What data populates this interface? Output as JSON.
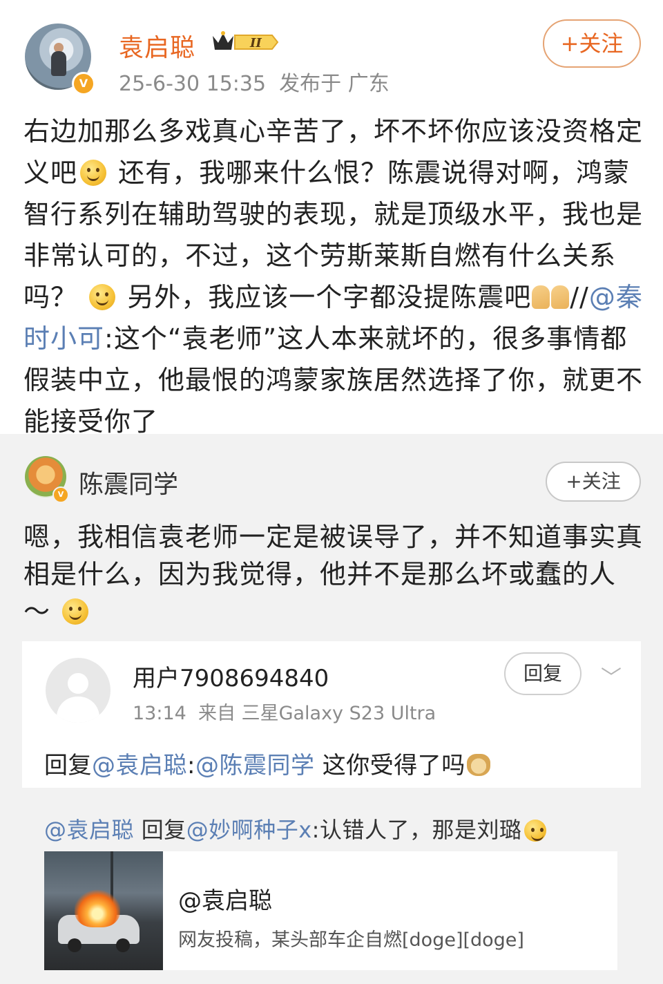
{
  "post": {
    "username": "袁启聪",
    "level_badge": "II",
    "time": "25-6-30 15:35",
    "location": "发布于 广东",
    "follow_label": "+关注",
    "text_part1": "右边加那么多戏真心辛苦了，坏不坏你应该没资格定义吧",
    "text_part2": " 还有，我哪来什么恨？陈震说得对啊，鸿蒙智行系列在辅助驾驶的表现，就是顶级水平，我也是非常认可的，不过，这个劳斯莱斯自燃有什么关系吗？",
    "text_part3": " 另外，我应该一个字都没提陈震吧",
    "text_part4": "//",
    "repost_mention": "@秦时小可",
    "text_part5": ":这个“袁老师”这人本来就坏的，很多事情都假装中立，他最恨的鸿蒙家族居然选择了你，就更不能接受你了"
  },
  "comment": {
    "username": "陈震同学",
    "follow_label": "+关注",
    "text": "嗯，我相信袁老师一定是被误导了，并不知道事实真相是什么，因为我觉得，他并不是那么坏或蠢的人～"
  },
  "reply": {
    "username": "用户7908694840",
    "time": "13:14",
    "source": "来自 三星Galaxy S23 Ultra",
    "reply_button": "回复",
    "prefix": "回复",
    "mention1": "@袁启聪",
    "colon": ":",
    "mention2": "@陈震同学",
    "text": " 这你受得了吗"
  },
  "lower_reply": {
    "mention1": "@袁启聪",
    "mid": " 回复",
    "mention2": "@妙啊种子x",
    "text": ":认错人了，那是刘璐"
  },
  "link_card": {
    "title": "@袁启聪",
    "subtitle": "网友投稿，某头部车企自燃[doge][doge]"
  },
  "icons": [
    "verified-icon",
    "crown-level-icon",
    "smile-emoji",
    "thinking-emoji",
    "pray-hands-emoji",
    "doge-emoji",
    "chevron-down-icon",
    "default-avatar-icon"
  ]
}
